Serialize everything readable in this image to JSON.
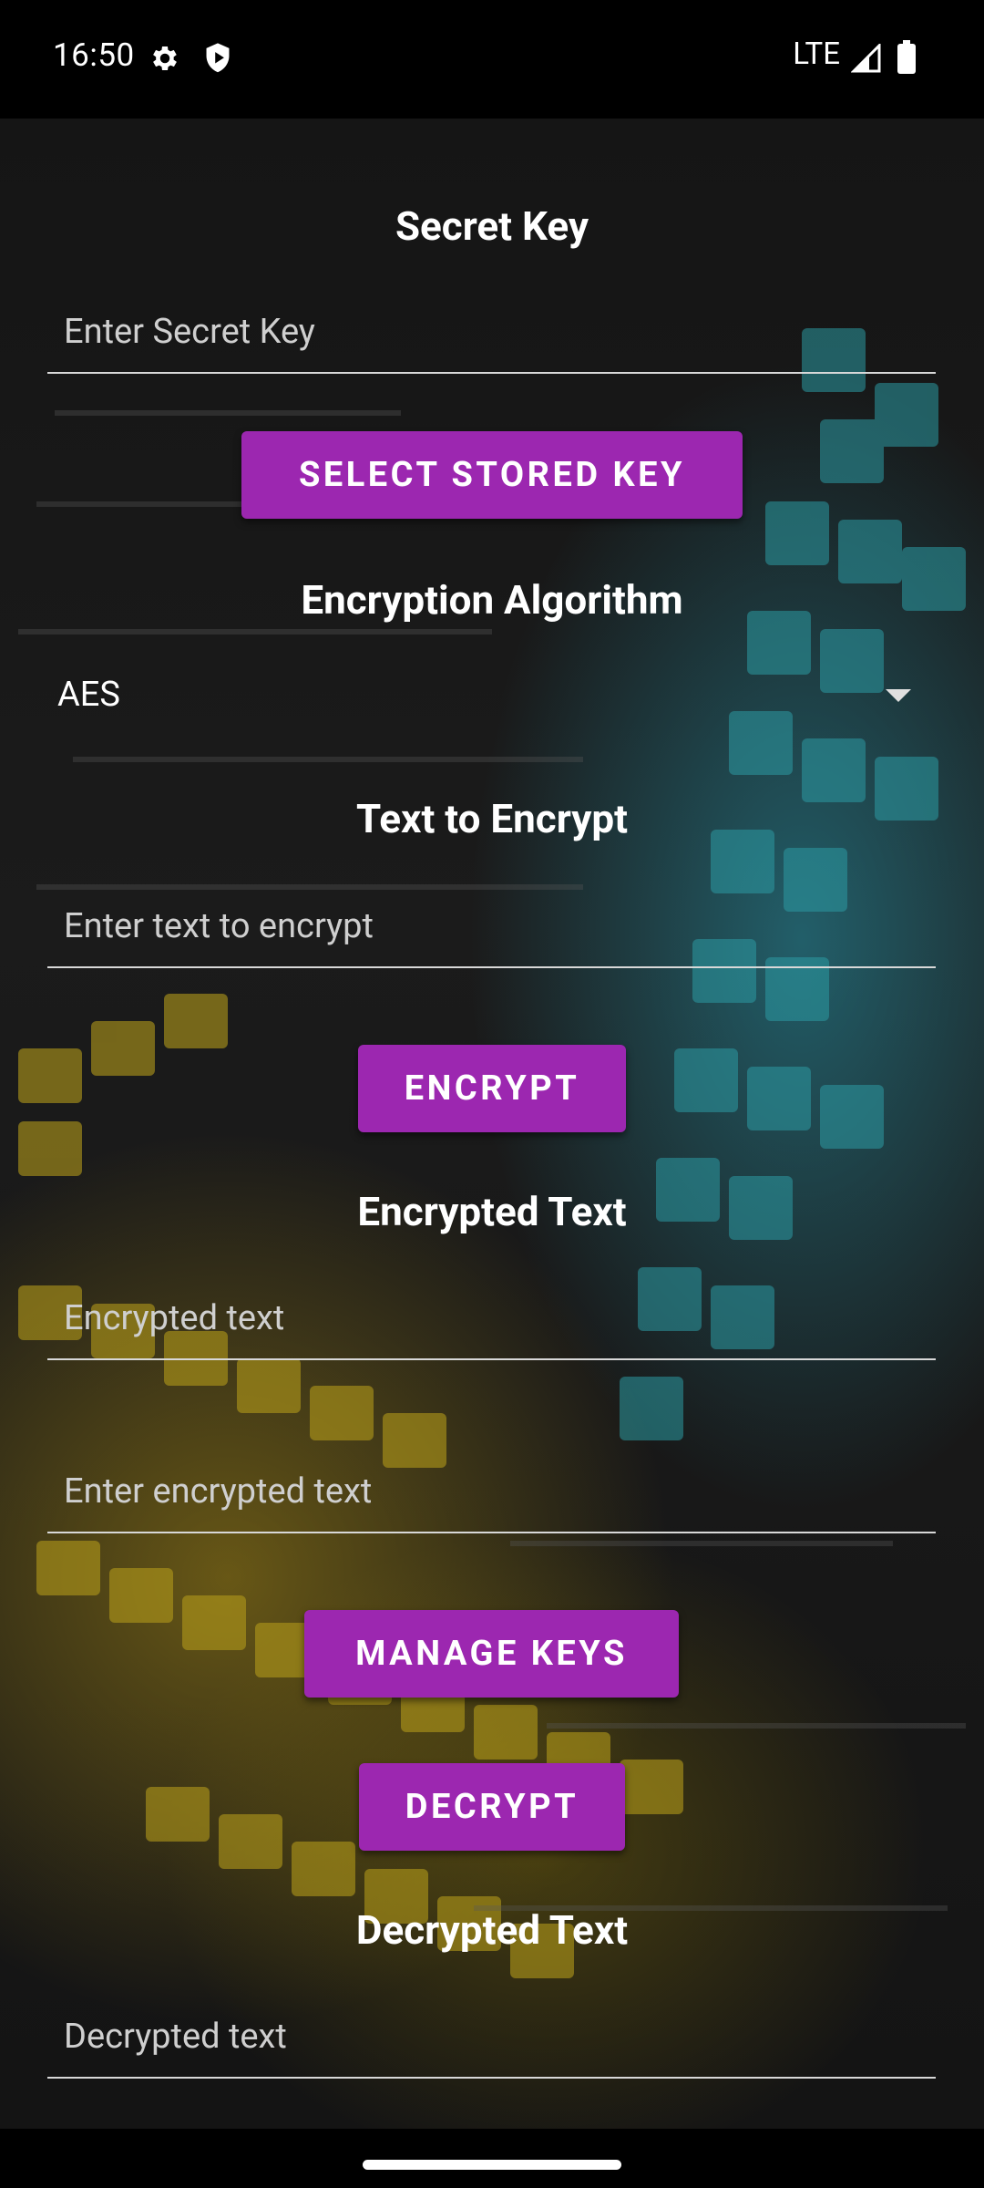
{
  "status_bar": {
    "time": "16:50",
    "network": "LTE",
    "icons": [
      "settings-icon",
      "shield-icon",
      "signal-icon",
      "battery-icon"
    ]
  },
  "form": {
    "secret_key": {
      "heading": "Secret Key",
      "placeholder": "Enter Secret Key",
      "value": ""
    },
    "select_stored_key_label": "SELECT STORED KEY",
    "algorithm": {
      "heading": "Encryption Algorithm",
      "selected": "AES"
    },
    "plain_text": {
      "heading": "Text to Encrypt",
      "placeholder": "Enter text to encrypt",
      "value": ""
    },
    "encrypt_label": "ENCRYPT",
    "encrypted": {
      "heading": "Encrypted Text",
      "placeholder": "Encrypted text",
      "value": ""
    },
    "encrypted_input": {
      "placeholder": "Enter encrypted text",
      "value": ""
    },
    "manage_keys_label": "MANAGE KEYS",
    "decrypt_label": "DECRYPT",
    "decrypted": {
      "heading": "Decrypted Text",
      "placeholder": "Decrypted text",
      "value": ""
    }
  },
  "colors": {
    "accent": "#9C27B0",
    "text": "#FFFFFF",
    "hint": "#CFCFCF",
    "underline": "#D8D8D8"
  }
}
